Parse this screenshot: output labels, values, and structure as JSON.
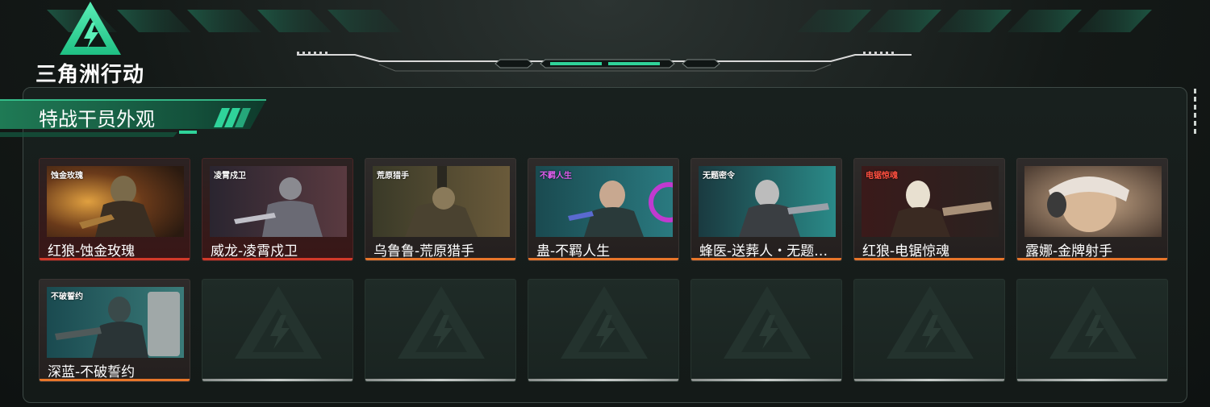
{
  "game": {
    "logo_text": "三角洲行动"
  },
  "section": {
    "title": "特战干员外观"
  },
  "colors": {
    "accent_green": "#2fd39a",
    "rarity_red": "#d23a2a",
    "rarity_orange": "#e8762a"
  },
  "skins": [
    {
      "name": "红狼-蚀金玫瑰",
      "thumb_tag": "蚀金玫瑰",
      "rarity": "red",
      "icon": "operator-portrait"
    },
    {
      "name": "威龙-凌霄戍卫",
      "thumb_tag": "凌霄戍卫",
      "rarity": "red",
      "icon": "operator-portrait"
    },
    {
      "name": "乌鲁鲁-荒原猎手",
      "thumb_tag": "荒原猎手",
      "rarity": "orange",
      "icon": "operator-portrait"
    },
    {
      "name": "蛊-不羁人生",
      "thumb_tag": "不羁人生",
      "rarity": "orange",
      "icon": "operator-portrait"
    },
    {
      "name": "蜂医-送葬人・无题…",
      "thumb_tag": "无题密令",
      "rarity": "orange",
      "icon": "operator-portrait"
    },
    {
      "name": "红狼-电锯惊魂",
      "thumb_tag": "电锯惊魂",
      "rarity": "orange",
      "icon": "operator-portrait"
    },
    {
      "name": "露娜-金牌射手",
      "thumb_tag": "",
      "rarity": "orange",
      "icon": "operator-portrait"
    },
    {
      "name": "深蓝-不破誓约",
      "thumb_tag": "不破誓约",
      "rarity": "orange",
      "icon": "operator-portrait"
    }
  ],
  "empty_slot_icon": "delta-logo-icon"
}
